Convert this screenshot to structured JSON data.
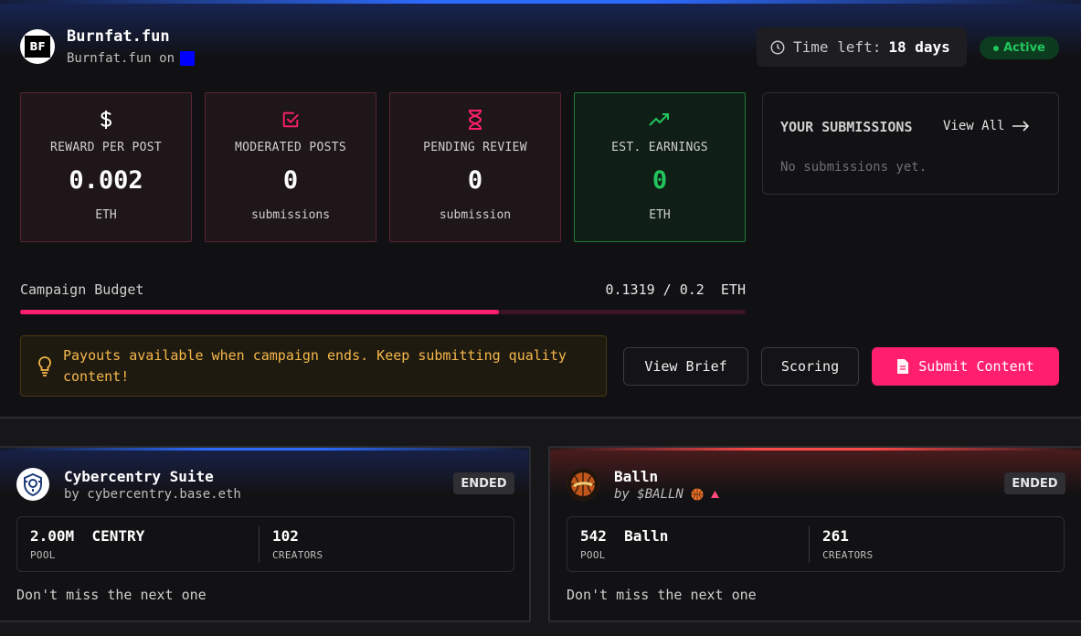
{
  "header": {
    "logo_text": "BF",
    "title": "Burnfat.fun",
    "subtitle": "Burnfat.fun on",
    "chain_color": "#0000ff",
    "time_label": "Time left:",
    "time_value": "18 days",
    "status": "Active"
  },
  "stats": [
    {
      "icon": "dollar-icon",
      "label": "REWARD PER POST",
      "value": "0.002",
      "unit": "ETH"
    },
    {
      "icon": "check-square-icon",
      "label": "MODERATED POSTS",
      "value": "0",
      "unit": "submissions"
    },
    {
      "icon": "hourglass-icon",
      "label": "PENDING REVIEW",
      "value": "0",
      "unit": "submission"
    },
    {
      "icon": "trending-up-icon",
      "label": "EST. EARNINGS",
      "value": "0",
      "unit": "ETH"
    }
  ],
  "submissions": {
    "title": "YOUR SUBMISSIONS",
    "view_all": "View All",
    "empty": "No submissions yet."
  },
  "budget": {
    "label": "Campaign Budget",
    "spent": "0.1319",
    "total": "0.2",
    "unit": "ETH",
    "fraction": 0.6595
  },
  "notice": {
    "text": "Payouts available when campaign ends. Keep submitting quality content!"
  },
  "actions": {
    "view_brief": "View Brief",
    "scoring": "Scoring",
    "submit": "Submit Content"
  },
  "campaigns": [
    {
      "title": "Cybercentry Suite",
      "by": "by cybercentry.base.eth",
      "status": "ENDED",
      "pool_value": "2.00M",
      "pool_token": "CENTRY",
      "pool_label": "POOL",
      "creators_value": "102",
      "creators_label": "CREATORS",
      "footer": "Don't miss the next one"
    },
    {
      "title": "Balln",
      "by": "by $BALLN",
      "status": "ENDED",
      "pool_value": "542",
      "pool_token": "Balln",
      "pool_label": "POOL",
      "creators_value": "261",
      "creators_label": "CREATORS",
      "footer": "Don't miss the next one"
    }
  ],
  "colors": {
    "accent": "#ff1f6d",
    "success": "#22c55e",
    "warning": "#f5b84a"
  }
}
